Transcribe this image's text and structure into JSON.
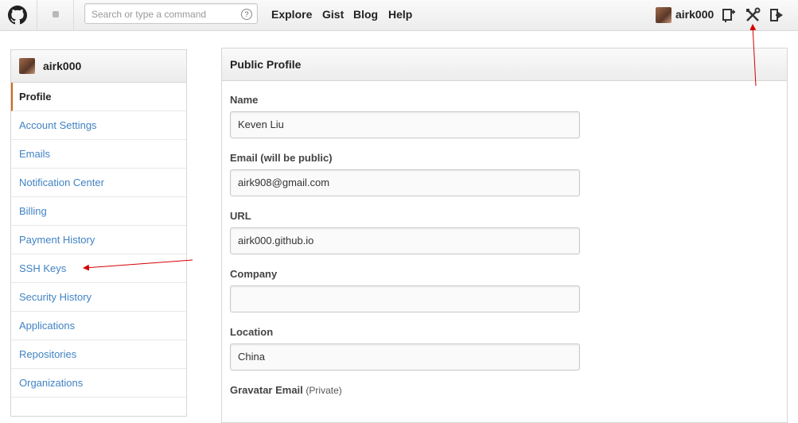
{
  "header": {
    "search_placeholder": "Search or type a command",
    "search_help": "?",
    "nav": [
      "Explore",
      "Gist",
      "Blog",
      "Help"
    ],
    "username": "airk000",
    "icons": [
      "github-octocat-icon",
      "new-repo-icon",
      "settings-tools-icon",
      "sign-out-icon"
    ]
  },
  "sidebar": {
    "username": "airk000",
    "items": [
      {
        "label": "Profile",
        "active": true
      },
      {
        "label": "Account Settings"
      },
      {
        "label": "Emails"
      },
      {
        "label": "Notification Center"
      },
      {
        "label": "Billing"
      },
      {
        "label": "Payment History"
      },
      {
        "label": "SSH Keys"
      },
      {
        "label": "Security History"
      },
      {
        "label": "Applications"
      },
      {
        "label": "Repositories"
      },
      {
        "label": "Organizations"
      }
    ]
  },
  "profile": {
    "title": "Public Profile",
    "fields": [
      {
        "label": "Name",
        "value": "Keven Liu"
      },
      {
        "label": "Email (will be public)",
        "value": "airk908@gmail.com"
      },
      {
        "label": "URL",
        "value": "airk000.github.io"
      },
      {
        "label": "Company",
        "value": ""
      },
      {
        "label": "Location",
        "value": "China"
      },
      {
        "label": "Gravatar Email",
        "note": "(Private)"
      }
    ]
  },
  "colors": {
    "link": "#4183c4",
    "active_marker": "#d26911",
    "annotation": "#d40000"
  }
}
